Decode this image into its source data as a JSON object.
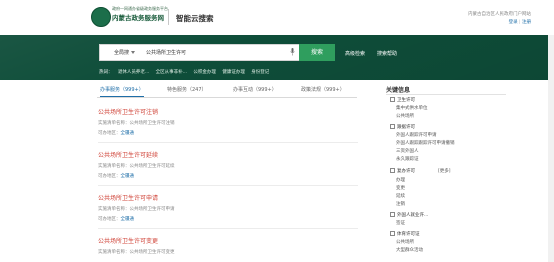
{
  "header": {
    "logo_sub": "政府一网通办省级政务服务平台",
    "logo_main": "内蒙古政务服务网",
    "site_name": "智能云搜索",
    "user_line": "内蒙古自治区人民政府门户网站",
    "login": "登录",
    "register": "注册",
    "link_separator": "|"
  },
  "search": {
    "scope": "全局搜",
    "query": "公共场所卫生许可",
    "button": "搜索",
    "advanced": "高级检索",
    "help": "搜索帮助"
  },
  "hot": {
    "label": "热词：",
    "keywords": [
      "退休人员养老...",
      "全区从事非补...",
      "公积金办理",
      "健康证办理",
      "身份登记"
    ]
  },
  "tabs": [
    {
      "label": "办事服务（999+）",
      "active": true
    },
    {
      "label": "特色服务（247）",
      "active": false
    },
    {
      "label": "办事互动（999+）",
      "active": false
    },
    {
      "label": "政策法规（999+）",
      "active": false
    }
  ],
  "results": [
    {
      "title": "公共场所卫生许可注销",
      "code_label": "实施清单名称：",
      "code_value": "公共场所卫生许可注销",
      "region_label": "可办地区：",
      "region_value": "全疆通"
    },
    {
      "title": "公共场所卫生许可延续",
      "code_label": "实施清单名称：",
      "code_value": "公共场所卫生许可延续",
      "region_label": "可办地区：",
      "region_value": "全疆通"
    },
    {
      "title": "公共场所卫生许可申请",
      "code_label": "实施清单名称：",
      "code_value": "公共场所卫生许可申请",
      "region_label": "可办地区：",
      "region_value": "全疆通"
    },
    {
      "title": "公共场所卫生许可变更",
      "code_label": "实施清单名称：",
      "code_value": "公共场所卫生许可变更",
      "region_label": "可办地区：",
      "region_value": "全疆通"
    },
    {
      "title": "公共场所卫生许可补办",
      "code_label": "实施清单名称：",
      "code_value": "公共场所卫生许可补办",
      "region_label": "可办地区：",
      "region_value": "全疆通"
    }
  ],
  "sidebar": {
    "title": "关键信息",
    "cats": [
      {
        "label": "卫生许可",
        "subs": [
          "集中式供水单位",
          "公共场所"
        ]
      },
      {
        "label": "跟据许可",
        "subs": [
          "外国人跟踪许可申请",
          "外国人跟踪跟踪许可申请撤销",
          "三资外国人",
          "永久跟踪证"
        ]
      },
      {
        "label": "复办许可",
        "badge": "[更多]",
        "subs": [
          "办理",
          "变更",
          "延续",
          "注销"
        ]
      },
      {
        "label": "外国人就业许...",
        "subs": [
          "签证"
        ]
      },
      {
        "label": "体育许可证",
        "subs": [
          "公共场所",
          "大型群众活动"
        ]
      }
    ]
  },
  "colors": {
    "banner": "#0e4d39",
    "accent": "#2f9e5e",
    "title_red": "#d0453a",
    "link_blue": "#1e6ea8"
  }
}
